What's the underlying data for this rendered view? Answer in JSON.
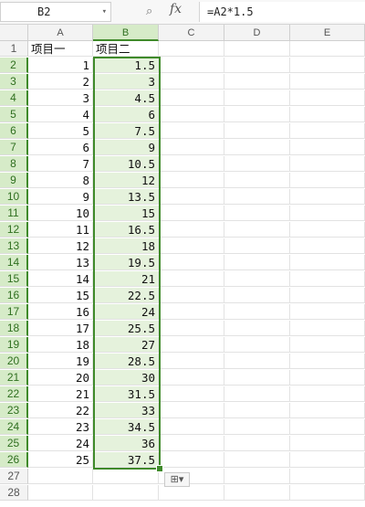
{
  "formula_bar": {
    "name_box": "B2",
    "fx_label": "fx",
    "formula": "=A2*1.5",
    "icons": [
      "dropdown-arrow-icon",
      "zoom-icon",
      "fx-icon"
    ]
  },
  "columns": [
    "A",
    "B",
    "C",
    "D",
    "E"
  ],
  "selected_column": "B",
  "rows": [
    {
      "n": "1",
      "a": "项目一",
      "b": "项目二"
    },
    {
      "n": "2",
      "a": "1",
      "b": "1.5"
    },
    {
      "n": "3",
      "a": "2",
      "b": "3"
    },
    {
      "n": "4",
      "a": "3",
      "b": "4.5"
    },
    {
      "n": "5",
      "a": "4",
      "b": "6"
    },
    {
      "n": "6",
      "a": "5",
      "b": "7.5"
    },
    {
      "n": "7",
      "a": "6",
      "b": "9"
    },
    {
      "n": "8",
      "a": "7",
      "b": "10.5"
    },
    {
      "n": "9",
      "a": "8",
      "b": "12"
    },
    {
      "n": "10",
      "a": "9",
      "b": "13.5"
    },
    {
      "n": "11",
      "a": "10",
      "b": "15"
    },
    {
      "n": "12",
      "a": "11",
      "b": "16.5"
    },
    {
      "n": "13",
      "a": "12",
      "b": "18"
    },
    {
      "n": "14",
      "a": "13",
      "b": "19.5"
    },
    {
      "n": "15",
      "a": "14",
      "b": "21"
    },
    {
      "n": "16",
      "a": "15",
      "b": "22.5"
    },
    {
      "n": "17",
      "a": "16",
      "b": "24"
    },
    {
      "n": "18",
      "a": "17",
      "b": "25.5"
    },
    {
      "n": "19",
      "a": "18",
      "b": "27"
    },
    {
      "n": "20",
      "a": "19",
      "b": "28.5"
    },
    {
      "n": "21",
      "a": "20",
      "b": "30"
    },
    {
      "n": "22",
      "a": "21",
      "b": "31.5"
    },
    {
      "n": "23",
      "a": "22",
      "b": "33"
    },
    {
      "n": "24",
      "a": "23",
      "b": "34.5"
    },
    {
      "n": "25",
      "a": "24",
      "b": "36"
    },
    {
      "n": "26",
      "a": "25",
      "b": "37.5"
    },
    {
      "n": "27",
      "a": "",
      "b": ""
    },
    {
      "n": "28",
      "a": "",
      "b": ""
    }
  ],
  "quick_fill_icon": "quick-fill-options-icon",
  "colors": {
    "selection": "#3f8a2a",
    "selection_fill": "#e5f2dc"
  }
}
